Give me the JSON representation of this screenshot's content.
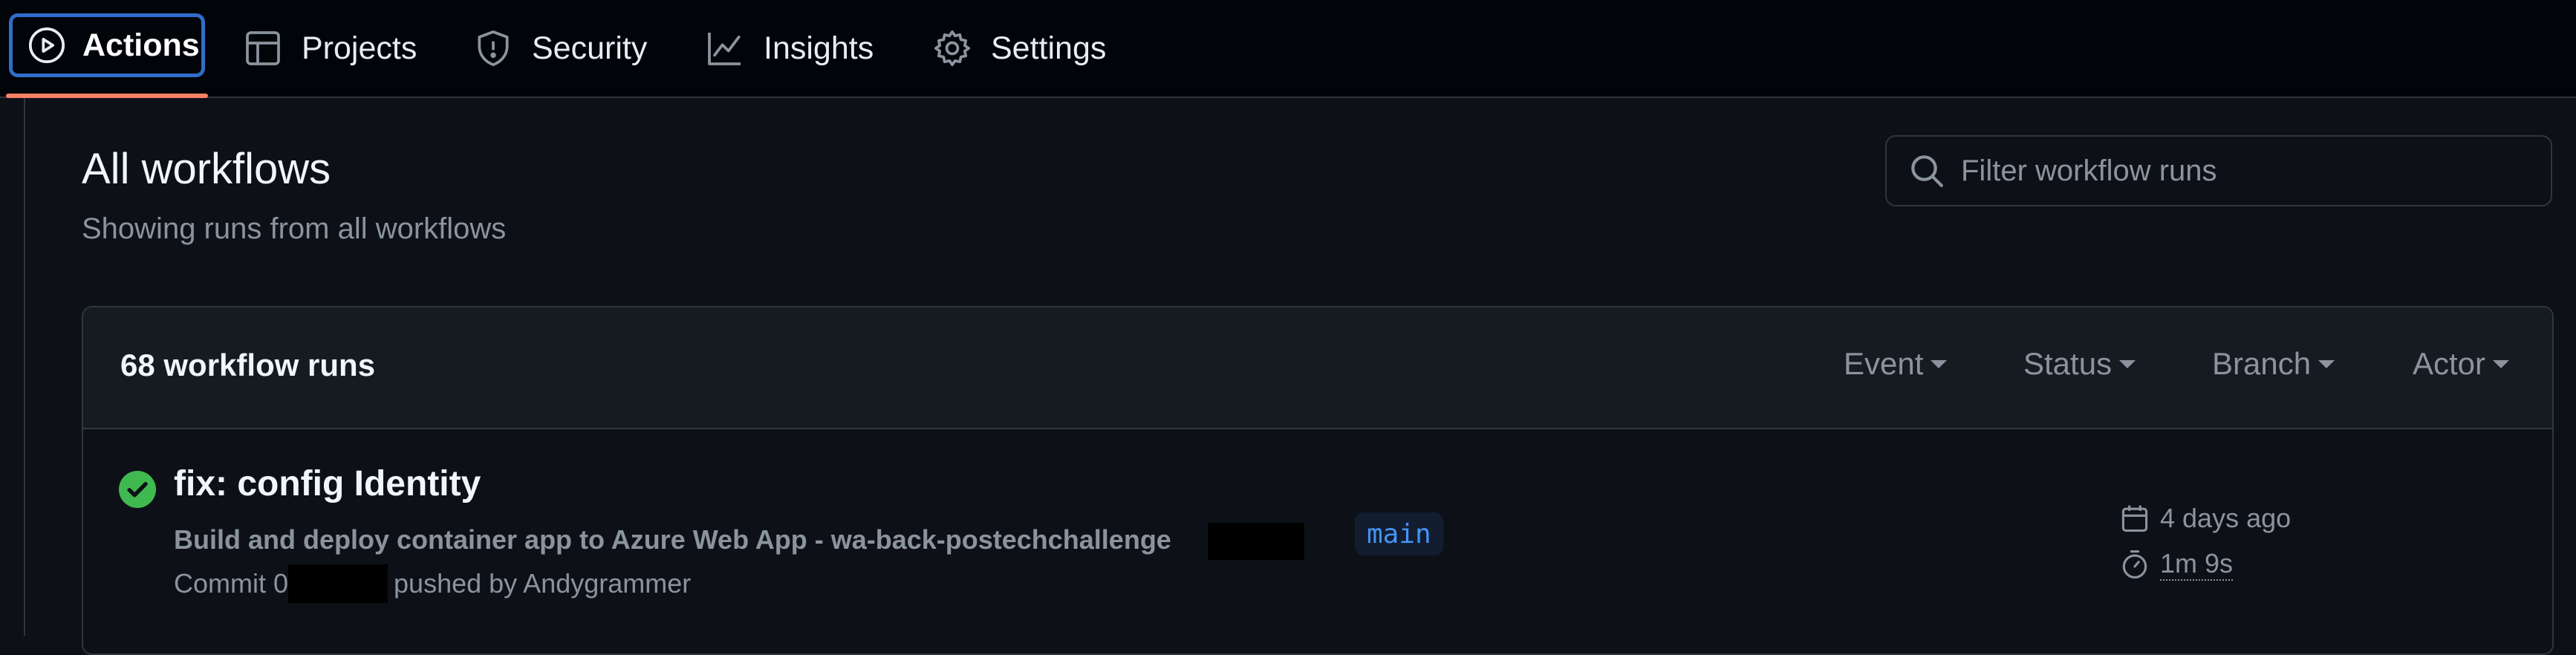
{
  "nav": {
    "tabs": [
      {
        "label": "Actions",
        "icon": "play-icon",
        "selected": true
      },
      {
        "label": "Projects",
        "icon": "table-icon"
      },
      {
        "label": "Security",
        "icon": "shield-icon"
      },
      {
        "label": "Insights",
        "icon": "graph-icon"
      },
      {
        "label": "Settings",
        "icon": "gear-icon"
      }
    ]
  },
  "header": {
    "title": "All workflows",
    "subtitle": "Showing runs from all workflows"
  },
  "filter": {
    "placeholder": "Filter workflow runs",
    "value": ""
  },
  "runs": {
    "count_label": "68 workflow runs",
    "filters": [
      "Event",
      "Status",
      "Branch",
      "Actor"
    ],
    "items": [
      {
        "status": "success",
        "title": "fix: config Identity",
        "workflow": "Build and deploy container app to Azure Web App - wa-back-postechchallenge",
        "branch": "main",
        "commit_prefix": "Commit 0",
        "pushed_by": "pushed by Andygrammer",
        "date": "4 days ago",
        "duration": "1m 9s"
      }
    ]
  },
  "colors": {
    "accent": "#316dca",
    "underline": "#f78166",
    "success": "#3fb950",
    "branch": "#4493f8"
  }
}
